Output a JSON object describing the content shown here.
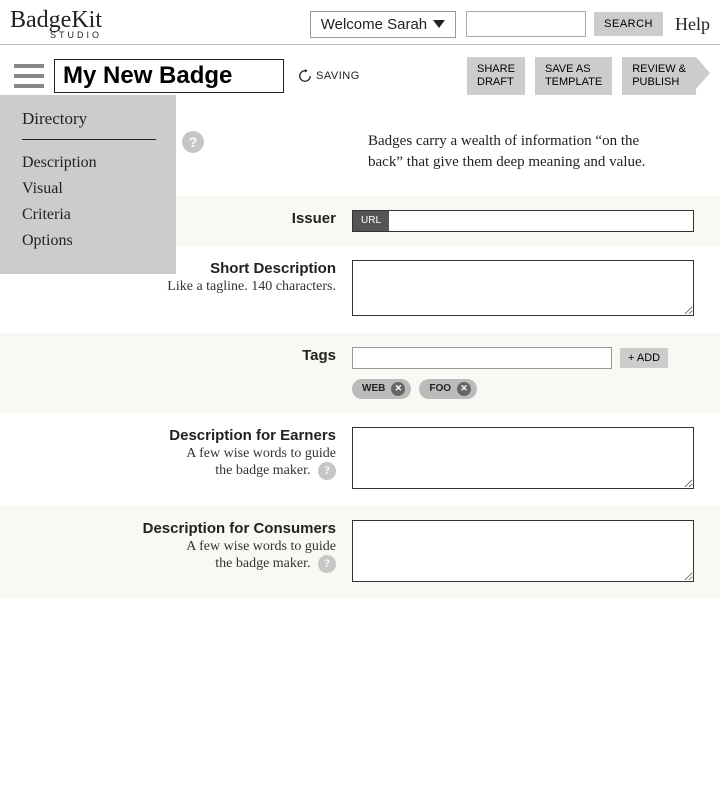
{
  "header": {
    "logo": "BadgeKit",
    "logo_sub": "STUDIO",
    "user_label": "Welcome Sarah",
    "search_btn": "SEARCH",
    "help": "Help"
  },
  "toolbar": {
    "badge_name": "My New Badge",
    "saving": "SAVING",
    "share_draft": "SHARE\nDRAFT",
    "save_template": "SAVE AS\nTEMPLATE",
    "review": "REVIEW &\nPUBLISH"
  },
  "menu": {
    "directory": "Directory",
    "items": [
      "Description",
      "Visual",
      "Criteria",
      "Options"
    ]
  },
  "intro": "Badges carry a wealth of information “on the back” that give them deep meaning and value.",
  "fields": {
    "issuer": {
      "label": "Issuer",
      "prefix": "URL"
    },
    "short_desc": {
      "label": "Short Description",
      "sub": "Like a tagline. 140 characters."
    },
    "tags": {
      "label": "Tags",
      "add": "+ ADD",
      "items": [
        "WEB",
        "FOO"
      ]
    },
    "earners": {
      "label": "Description for Earners",
      "sub": "A few wise words to guide\nthe badge maker."
    },
    "consumers": {
      "label": "Description for Consumers",
      "sub": "A few wise words to guide\nthe badge maker."
    }
  }
}
